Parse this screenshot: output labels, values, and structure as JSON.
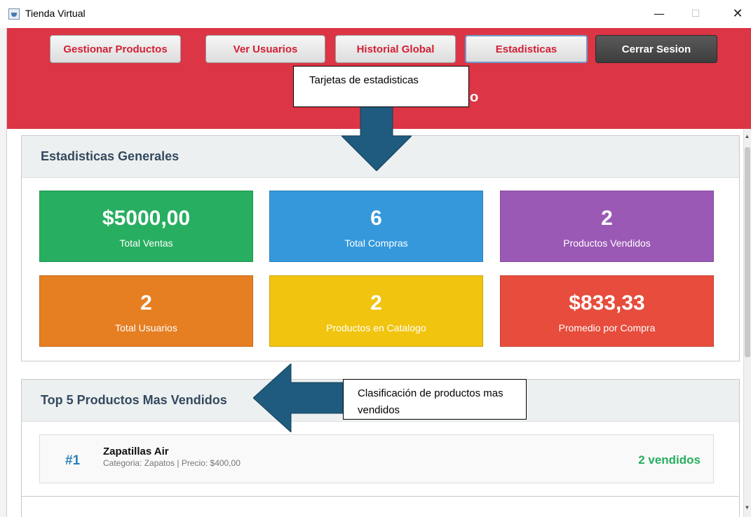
{
  "window": {
    "title": "Tienda Virtual",
    "minimize_glyph": "—",
    "maximize_glyph": "☐",
    "close_glyph": "✕"
  },
  "nav": {
    "products": "Gestionar Productos",
    "users": "Ver Usuarios",
    "history": "Historial Global",
    "stats": "Estadisticas",
    "logout": "Cerrar Sesion"
  },
  "header": {
    "title_fragment": "o"
  },
  "annotations": {
    "stats_cards": "Tarjetas de estadisticas",
    "top_ranking": "Clasificación de productos mas vendidos"
  },
  "stats_panel": {
    "title": "Estadisticas Generales",
    "cards": [
      {
        "value": "$5000,00",
        "label": "Total Ventas",
        "color": "#27ae60"
      },
      {
        "value": "6",
        "label": "Total Compras",
        "color": "#3498db"
      },
      {
        "value": "2",
        "label": "Productos Vendidos",
        "color": "#9b59b6"
      },
      {
        "value": "2",
        "label": "Total Usuarios",
        "color": "#e67e22"
      },
      {
        "value": "2",
        "label": "Productos en Catalogo",
        "color": "#f1c40f"
      },
      {
        "value": "$833,33",
        "label": "Promedio por Compra",
        "color": "#e74c3c"
      }
    ]
  },
  "top_panel": {
    "title": "Top 5 Productos Mas Vendidos",
    "items": [
      {
        "rank": "#1",
        "name": "Zapatillas Air",
        "info": "Categoria: Zapatos | Precio: $400,00",
        "sold": "2 vendidos"
      }
    ]
  },
  "colors": {
    "header": "#dc3545",
    "arrow": "#1f5b7e",
    "panel_title": "#34495e"
  }
}
